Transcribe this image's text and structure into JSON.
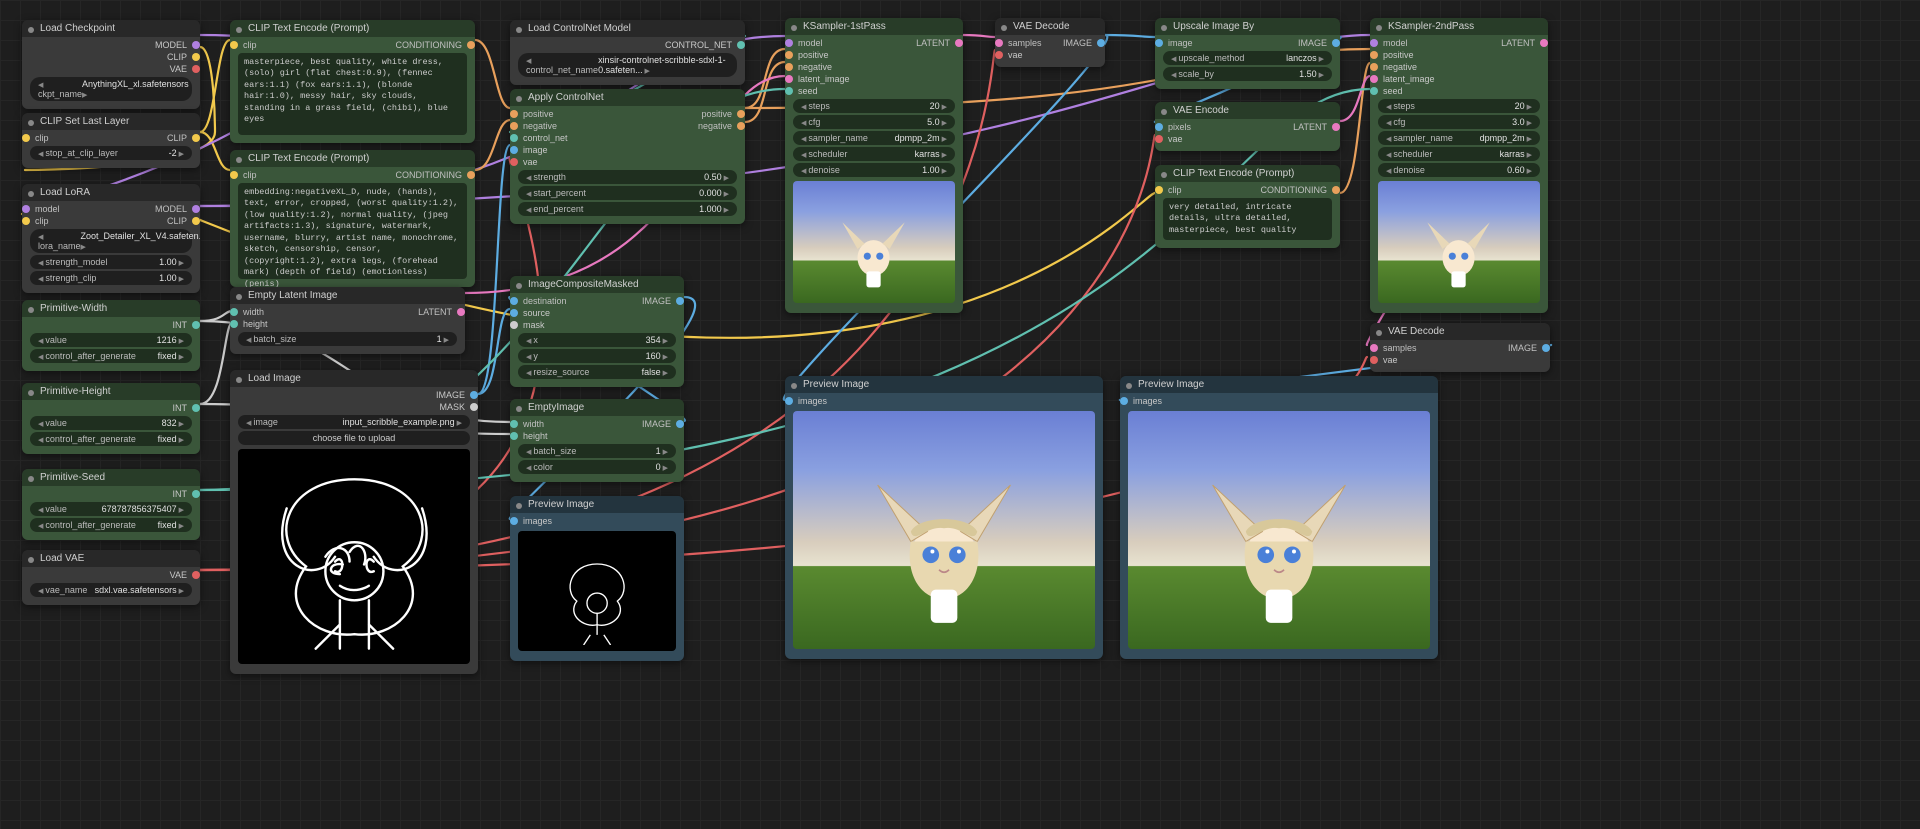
{
  "nodes": {
    "load_checkpoint": {
      "title": "Load Checkpoint",
      "outputs": [
        "MODEL",
        "CLIP",
        "VAE"
      ],
      "widgets": [
        {
          "name": "ckpt_name",
          "value": "AnythingXL_xl.safetensors"
        }
      ]
    },
    "clip_set_last_layer": {
      "title": "CLIP Set Last Layer",
      "inputs": [
        {
          "name": "clip",
          "color": "yellow"
        }
      ],
      "outputs": [
        "CLIP"
      ],
      "widgets": [
        {
          "name": "stop_at_clip_layer",
          "value": "-2"
        }
      ]
    },
    "load_lora": {
      "title": "Load LoRA",
      "inputs": [
        {
          "name": "model",
          "color": "purple"
        },
        {
          "name": "clip",
          "color": "yellow"
        }
      ],
      "outputs": [
        "MODEL",
        "CLIP"
      ],
      "widgets": [
        {
          "name": "lora_name",
          "value": "Zoot_Detailer_XL_V4.safeten..."
        },
        {
          "name": "strength_model",
          "value": "1.00"
        },
        {
          "name": "strength_clip",
          "value": "1.00"
        }
      ]
    },
    "primitive_width": {
      "title": "Primitive-Width",
      "outputs": [
        "INT"
      ],
      "widgets": [
        {
          "name": "value",
          "value": "1216"
        },
        {
          "name": "control_after_generate",
          "value": "fixed"
        }
      ]
    },
    "primitive_height": {
      "title": "Primitive-Height",
      "outputs": [
        "INT"
      ],
      "widgets": [
        {
          "name": "value",
          "value": "832"
        },
        {
          "name": "control_after_generate",
          "value": "fixed"
        }
      ]
    },
    "primitive_seed": {
      "title": "Primitive-Seed",
      "outputs": [
        "INT"
      ],
      "widgets": [
        {
          "name": "value",
          "value": "678787856375407"
        },
        {
          "name": "control_after_generate",
          "value": "fixed"
        }
      ]
    },
    "load_vae": {
      "title": "Load VAE",
      "outputs": [
        "VAE"
      ],
      "widgets": [
        {
          "name": "vae_name",
          "value": "sdxl.vae.safetensors"
        }
      ]
    },
    "clip_text_pos": {
      "title": "CLIP Text Encode (Prompt)",
      "inputs": [
        {
          "name": "clip",
          "color": "yellow"
        }
      ],
      "outputs": [
        "CONDITIONING"
      ],
      "text": "masterpiece, best quality, white dress, (solo) girl (flat chest:0.9), (fennec ears:1.1) (fox ears:1.1), (blonde hair:1.0), messy hair, sky clouds, standing in a grass field, (chibi), blue eyes"
    },
    "clip_text_neg": {
      "title": "CLIP Text Encode (Prompt)",
      "inputs": [
        {
          "name": "clip",
          "color": "yellow"
        }
      ],
      "outputs": [
        "CONDITIONING"
      ],
      "text": "embedding:negativeXL_D, nude, (hands), text, error, cropped, (worst quality:1.2), (low quality:1.2), normal quality, (jpeg artifacts:1.3), signature, watermark, username, blurry, artist name, monochrome, sketch, censorship, censor, (copyright:1.2), extra legs, (forehead mark) (depth of field) (emotionless) (penis)"
    },
    "empty_latent": {
      "title": "Empty Latent Image",
      "inputs": [
        {
          "name": "width",
          "color": "teal"
        },
        {
          "name": "height",
          "color": "teal"
        }
      ],
      "outputs": [
        "LATENT"
      ],
      "widgets": [
        {
          "name": "batch_size",
          "value": "1"
        }
      ]
    },
    "load_image": {
      "title": "Load Image",
      "outputs": [
        "IMAGE",
        "MASK"
      ],
      "widgets": [
        {
          "name": "image",
          "value": "input_scribble_example.png"
        }
      ],
      "button": "choose file to upload"
    },
    "load_controlnet": {
      "title": "Load ControlNet Model",
      "outputs": [
        "CONTROL_NET"
      ],
      "widgets": [
        {
          "name": "control_net_name",
          "value": "xinsir-controlnet-scribble-sdxl-1-0.safeten..."
        }
      ]
    },
    "apply_controlnet": {
      "title": "Apply ControlNet",
      "inputs": [
        {
          "name": "positive",
          "color": "orange"
        },
        {
          "name": "negative",
          "color": "orange"
        },
        {
          "name": "control_net",
          "color": "teal"
        },
        {
          "name": "image",
          "color": "blue"
        },
        {
          "name": "vae",
          "color": "red"
        }
      ],
      "outputs": [
        "positive",
        "negative"
      ],
      "widgets": [
        {
          "name": "strength",
          "value": "0.50"
        },
        {
          "name": "start_percent",
          "value": "0.000"
        },
        {
          "name": "end_percent",
          "value": "1.000"
        }
      ]
    },
    "image_composite": {
      "title": "ImageCompositeMasked",
      "inputs": [
        {
          "name": "destination",
          "color": "blue"
        },
        {
          "name": "source",
          "color": "blue"
        },
        {
          "name": "mask",
          "color": "grey"
        }
      ],
      "outputs": [
        "IMAGE"
      ],
      "widgets": [
        {
          "name": "x",
          "value": "354"
        },
        {
          "name": "y",
          "value": "160"
        },
        {
          "name": "resize_source",
          "value": "false"
        }
      ]
    },
    "empty_image": {
      "title": "EmptyImage",
      "inputs": [
        {
          "name": "width",
          "color": "teal"
        },
        {
          "name": "height",
          "color": "teal"
        }
      ],
      "outputs": [
        "IMAGE"
      ],
      "widgets": [
        {
          "name": "batch_size",
          "value": "1"
        },
        {
          "name": "color",
          "value": "0"
        }
      ]
    },
    "preview_small": {
      "title": "Preview Image",
      "inputs": [
        {
          "name": "images",
          "color": "blue"
        }
      ]
    },
    "ksampler1": {
      "title": "KSampler-1stPass",
      "inputs": [
        {
          "name": "model",
          "color": "purple"
        },
        {
          "name": "positive",
          "color": "orange"
        },
        {
          "name": "negative",
          "color": "orange"
        },
        {
          "name": "latent_image",
          "color": "pink"
        },
        {
          "name": "seed",
          "color": "teal"
        }
      ],
      "outputs": [
        "LATENT"
      ],
      "widgets": [
        {
          "name": "steps",
          "value": "20"
        },
        {
          "name": "cfg",
          "value": "5.0"
        },
        {
          "name": "sampler_name",
          "value": "dpmpp_2m"
        },
        {
          "name": "scheduler",
          "value": "karras"
        },
        {
          "name": "denoise",
          "value": "1.00"
        }
      ]
    },
    "vae_decode1": {
      "title": "VAE Decode",
      "inputs": [
        {
          "name": "samples",
          "color": "pink"
        },
        {
          "name": "vae",
          "color": "red"
        }
      ],
      "outputs": [
        "IMAGE"
      ]
    },
    "upscale": {
      "title": "Upscale Image By",
      "inputs": [
        {
          "name": "image",
          "color": "blue"
        }
      ],
      "outputs": [
        "IMAGE"
      ],
      "widgets": [
        {
          "name": "upscale_method",
          "value": "lanczos"
        },
        {
          "name": "scale_by",
          "value": "1.50"
        }
      ]
    },
    "vae_encode": {
      "title": "VAE Encode",
      "inputs": [
        {
          "name": "pixels",
          "color": "blue"
        },
        {
          "name": "vae",
          "color": "red"
        }
      ],
      "outputs": [
        "LATENT"
      ]
    },
    "clip_text_detail": {
      "title": "CLIP Text Encode (Prompt)",
      "inputs": [
        {
          "name": "clip",
          "color": "yellow"
        }
      ],
      "outputs": [
        "CONDITIONING"
      ],
      "text": "very detailed, intricate details, ultra detailed, masterpiece, best quality"
    },
    "ksampler2": {
      "title": "KSampler-2ndPass",
      "inputs": [
        {
          "name": "model",
          "color": "purple"
        },
        {
          "name": "positive",
          "color": "orange"
        },
        {
          "name": "negative",
          "color": "orange"
        },
        {
          "name": "latent_image",
          "color": "pink"
        },
        {
          "name": "seed",
          "color": "teal"
        }
      ],
      "outputs": [
        "LATENT"
      ],
      "widgets": [
        {
          "name": "steps",
          "value": "20"
        },
        {
          "name": "cfg",
          "value": "3.0"
        },
        {
          "name": "sampler_name",
          "value": "dpmpp_2m"
        },
        {
          "name": "scheduler",
          "value": "karras"
        },
        {
          "name": "denoise",
          "value": "0.60"
        }
      ]
    },
    "vae_decode2": {
      "title": "VAE Decode",
      "inputs": [
        {
          "name": "samples",
          "color": "pink"
        },
        {
          "name": "vae",
          "color": "red"
        }
      ],
      "outputs": [
        "IMAGE"
      ]
    },
    "preview1": {
      "title": "Preview Image",
      "inputs": [
        {
          "name": "images",
          "color": "blue"
        }
      ]
    },
    "preview2": {
      "title": "Preview Image",
      "inputs": [
        {
          "name": "images",
          "color": "blue"
        }
      ]
    }
  }
}
